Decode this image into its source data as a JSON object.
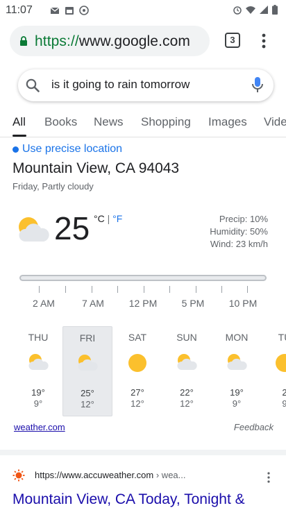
{
  "status_bar": {
    "time": "11:07",
    "left_icons": [
      "gmail-icon",
      "calendar-icon",
      "dnd-icon"
    ],
    "right_icons": [
      "alarm-icon",
      "wifi-icon",
      "signal-icon",
      "battery-icon"
    ]
  },
  "browser": {
    "url_scheme": "https://",
    "url_host": "www.google.com",
    "tab_count": "3"
  },
  "search": {
    "query": "is it going to rain tomorrow"
  },
  "tabs": [
    {
      "label": "All",
      "active": true
    },
    {
      "label": "Books"
    },
    {
      "label": "News"
    },
    {
      "label": "Shopping"
    },
    {
      "label": "Images"
    },
    {
      "label": "Vide"
    }
  ],
  "weather": {
    "precise_location": "Use precise location",
    "location": "Mountain View, CA 94043",
    "date_condition": "Friday, Partly cloudy",
    "temperature": "25",
    "unit_c": "°C",
    "unit_sep": " | ",
    "unit_f": "°F",
    "precip": "Precip: 10%",
    "humidity": "Humidity: 50%",
    "wind": "Wind: 23 km/h",
    "hours": [
      "2 AM",
      "7 AM",
      "12 PM",
      "5 PM",
      "10 PM"
    ],
    "days": [
      {
        "name": "THU",
        "icon": "partly-cloudy-icon",
        "high": "19°",
        "low": "9°"
      },
      {
        "name": "FRI",
        "icon": "partly-cloudy-icon",
        "high": "25°",
        "low": "12°",
        "selected": true
      },
      {
        "name": "SAT",
        "icon": "sunny-icon",
        "high": "27°",
        "low": "12°"
      },
      {
        "name": "SUN",
        "icon": "partly-cloudy-icon",
        "high": "22°",
        "low": "12°"
      },
      {
        "name": "MON",
        "icon": "partly-cloudy-icon",
        "high": "19°",
        "low": "9°"
      },
      {
        "name": "TU",
        "icon": "sunny-icon",
        "high": "2",
        "low": "9"
      }
    ],
    "source_link": "weather.com",
    "feedback": "Feedback"
  },
  "result": {
    "url": "https://www.accuweather.com",
    "path": " › wea...",
    "title": "Mountain View, CA Today, Tonight &"
  },
  "colors": {
    "accent_blue": "#1a73e8",
    "link_blue": "#1a0dab",
    "secure_green": "#0b7a36",
    "sun_yellow": "#fbc02d"
  }
}
